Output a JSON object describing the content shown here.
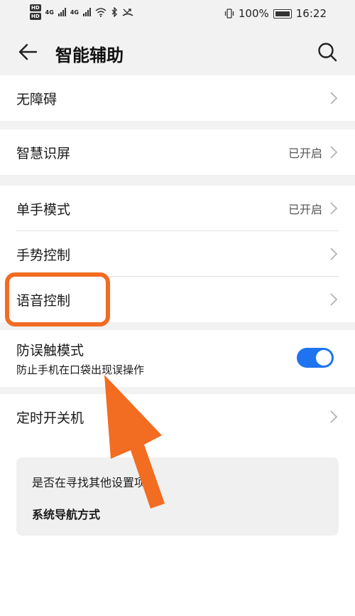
{
  "status_bar": {
    "hd1": "HD",
    "hd2": "HD",
    "net1": "4G",
    "net2": "4G",
    "battery_percent": "100%",
    "time": "16:22"
  },
  "header": {
    "title": "智能辅助"
  },
  "rows": {
    "accessibility": {
      "label": "无障碍"
    },
    "smart_screen": {
      "label": "智慧识屏",
      "value": "已开启"
    },
    "one_hand": {
      "label": "单手模式",
      "value": "已开启"
    },
    "gesture": {
      "label": "手势控制"
    },
    "voice": {
      "label": "语音控制"
    },
    "pocket": {
      "label": "防误触模式",
      "sub": "防止手机在口袋出现误操作",
      "toggle_on": true
    },
    "scheduled": {
      "label": "定时开关机"
    }
  },
  "suggest": {
    "question": "是否在寻找其他设置项？",
    "link": "系统导航方式"
  },
  "colors": {
    "accent": "#1e74f0",
    "highlight": "#f26c22"
  }
}
